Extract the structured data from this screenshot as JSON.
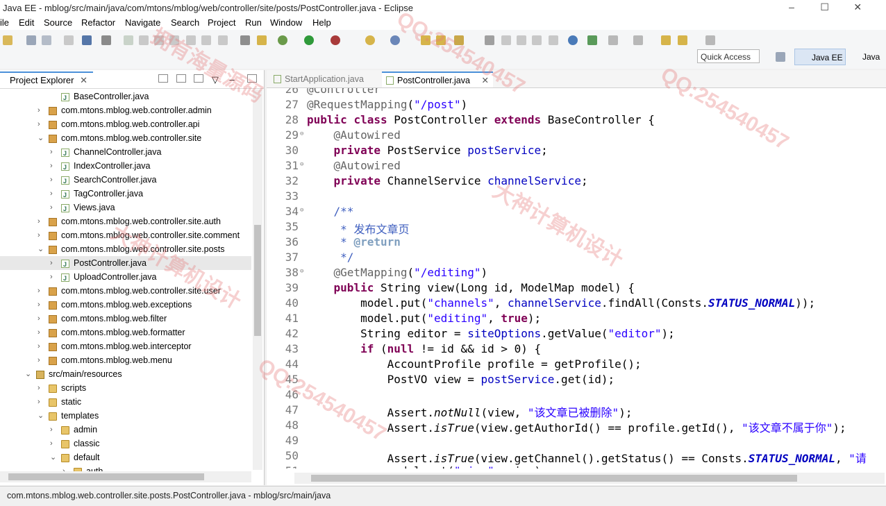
{
  "window": {
    "title": "Java EE - mblog/src/main/java/com/mtons/mblog/web/controller/site/posts/PostController.java - Eclipse"
  },
  "menu": [
    "ile",
    "Edit",
    "Source",
    "Refactor",
    "Navigate",
    "Search",
    "Project",
    "Run",
    "Window",
    "Help"
  ],
  "quick_access": {
    "placeholder": "Quick Access"
  },
  "perspectives": [
    {
      "label": "Java EE",
      "active": true
    },
    {
      "label": "Java",
      "active": false
    }
  ],
  "project_explorer": {
    "title": "Project Explorer",
    "rows": [
      {
        "label": "BaseController.java",
        "indent": 3,
        "icon": "java-file-icon",
        "arrow": ""
      },
      {
        "label": "com.mtons.mblog.web.controller.admin",
        "indent": 2,
        "icon": "package-icon",
        "arrow": ">"
      },
      {
        "label": "com.mtons.mblog.web.controller.api",
        "indent": 2,
        "icon": "package-icon",
        "arrow": ">"
      },
      {
        "label": "com.mtons.mblog.web.controller.site",
        "indent": 2,
        "icon": "package-icon",
        "arrow": "v"
      },
      {
        "label": "ChannelController.java",
        "indent": 3,
        "icon": "java-file-icon",
        "arrow": ">"
      },
      {
        "label": "IndexController.java",
        "indent": 3,
        "icon": "java-file-icon",
        "arrow": ">"
      },
      {
        "label": "SearchController.java",
        "indent": 3,
        "icon": "java-file-icon",
        "arrow": ">"
      },
      {
        "label": "TagController.java",
        "indent": 3,
        "icon": "java-file-icon",
        "arrow": ">"
      },
      {
        "label": "Views.java",
        "indent": 3,
        "icon": "java-file-icon",
        "arrow": ">"
      },
      {
        "label": "com.mtons.mblog.web.controller.site.auth",
        "indent": 2,
        "icon": "package-icon",
        "arrow": ">"
      },
      {
        "label": "com.mtons.mblog.web.controller.site.comment",
        "indent": 2,
        "icon": "package-icon",
        "arrow": ">"
      },
      {
        "label": "com.mtons.mblog.web.controller.site.posts",
        "indent": 2,
        "icon": "package-icon",
        "arrow": "v"
      },
      {
        "label": "PostController.java",
        "indent": 3,
        "icon": "java-file-icon",
        "arrow": ">",
        "selected": true
      },
      {
        "label": "UploadController.java",
        "indent": 3,
        "icon": "java-file-icon",
        "arrow": ">"
      },
      {
        "label": "com.mtons.mblog.web.controller.site.user",
        "indent": 2,
        "icon": "package-icon",
        "arrow": ">"
      },
      {
        "label": "com.mtons.mblog.web.exceptions",
        "indent": 2,
        "icon": "package-icon",
        "arrow": ">"
      },
      {
        "label": "com.mtons.mblog.web.filter",
        "indent": 2,
        "icon": "package-icon",
        "arrow": ">"
      },
      {
        "label": "com.mtons.mblog.web.formatter",
        "indent": 2,
        "icon": "package-icon",
        "arrow": ">"
      },
      {
        "label": "com.mtons.mblog.web.interceptor",
        "indent": 2,
        "icon": "package-icon",
        "arrow": ">"
      },
      {
        "label": "com.mtons.mblog.web.menu",
        "indent": 2,
        "icon": "package-icon",
        "arrow": ">"
      },
      {
        "label": "src/main/resources",
        "indent": 1,
        "icon": "source-folder-icon",
        "arrow": "v"
      },
      {
        "label": "scripts",
        "indent": 2,
        "icon": "folder-icon",
        "arrow": ">"
      },
      {
        "label": "static",
        "indent": 2,
        "icon": "folder-icon",
        "arrow": ">"
      },
      {
        "label": "templates",
        "indent": 2,
        "icon": "folder-icon",
        "arrow": "v"
      },
      {
        "label": "admin",
        "indent": 3,
        "icon": "folder-icon",
        "arrow": ">"
      },
      {
        "label": "classic",
        "indent": 3,
        "icon": "folder-icon",
        "arrow": ">"
      },
      {
        "label": "default",
        "indent": 3,
        "icon": "folder-icon",
        "arrow": "v"
      },
      {
        "label": "auth",
        "indent": 4,
        "icon": "folder-icon",
        "arrow": ">"
      }
    ]
  },
  "editor": {
    "tabs": [
      {
        "label": "StartApplication.java",
        "active": false
      },
      {
        "label": "PostController.java",
        "active": true
      }
    ],
    "lines": [
      {
        "n": "26",
        "fold": false,
        "segs": [
          [
            "an",
            "@Controller"
          ]
        ]
      },
      {
        "n": "27",
        "fold": false,
        "segs": [
          [
            "an",
            "@RequestMapping"
          ],
          [
            "",
            "("
          ],
          [
            "str",
            "\"/post\""
          ],
          [
            "",
            ")"
          ]
        ]
      },
      {
        "n": "28",
        "fold": false,
        "segs": [
          [
            "kw",
            "public"
          ],
          [
            "",
            " "
          ],
          [
            "kw",
            "class"
          ],
          [
            "",
            " PostController "
          ],
          [
            "kw",
            "extends"
          ],
          [
            "",
            " BaseController {"
          ]
        ]
      },
      {
        "n": "29",
        "fold": true,
        "segs": [
          [
            "",
            "    "
          ],
          [
            "an",
            "@Autowired"
          ]
        ]
      },
      {
        "n": "30",
        "fold": false,
        "segs": [
          [
            "",
            "    "
          ],
          [
            "kw",
            "private"
          ],
          [
            "",
            " PostService "
          ],
          [
            "fld",
            "postService"
          ],
          [
            "",
            ";"
          ]
        ]
      },
      {
        "n": "31",
        "fold": true,
        "segs": [
          [
            "",
            "    "
          ],
          [
            "an",
            "@Autowired"
          ]
        ]
      },
      {
        "n": "32",
        "fold": false,
        "segs": [
          [
            "",
            "    "
          ],
          [
            "kw",
            "private"
          ],
          [
            "",
            " ChannelService "
          ],
          [
            "fld",
            "channelService"
          ],
          [
            "",
            ";"
          ]
        ]
      },
      {
        "n": "33",
        "fold": false,
        "segs": []
      },
      {
        "n": "34",
        "fold": true,
        "segs": [
          [
            "",
            "    "
          ],
          [
            "cm",
            "/**"
          ]
        ]
      },
      {
        "n": "35",
        "fold": false,
        "segs": [
          [
            "",
            "     "
          ],
          [
            "cm",
            "* 发布文章页"
          ]
        ]
      },
      {
        "n": "36",
        "fold": false,
        "segs": [
          [
            "",
            "     "
          ],
          [
            "cm",
            "* "
          ],
          [
            "cmt",
            "@return"
          ]
        ]
      },
      {
        "n": "37",
        "fold": false,
        "segs": [
          [
            "",
            "     "
          ],
          [
            "cm",
            "*/"
          ]
        ]
      },
      {
        "n": "38",
        "fold": true,
        "segs": [
          [
            "",
            "    "
          ],
          [
            "an",
            "@GetMapping"
          ],
          [
            "",
            "("
          ],
          [
            "str",
            "\"/editing\""
          ],
          [
            "",
            ")"
          ]
        ]
      },
      {
        "n": "39",
        "fold": false,
        "segs": [
          [
            "",
            "    "
          ],
          [
            "kw",
            "public"
          ],
          [
            "",
            " String view(Long id, ModelMap model) {"
          ]
        ]
      },
      {
        "n": "40",
        "fold": false,
        "segs": [
          [
            "",
            "        model.put("
          ],
          [
            "str",
            "\"channels\""
          ],
          [
            "",
            ", "
          ],
          [
            "fld",
            "channelService"
          ],
          [
            "",
            ".findAll(Consts."
          ],
          [
            "sfld",
            "STATUS_NORMAL"
          ],
          [
            "",
            "));"
          ]
        ]
      },
      {
        "n": "41",
        "fold": false,
        "segs": [
          [
            "",
            "        model.put("
          ],
          [
            "str",
            "\"editing\""
          ],
          [
            "",
            ", "
          ],
          [
            "kw",
            "true"
          ],
          [
            "",
            ");"
          ]
        ]
      },
      {
        "n": "42",
        "fold": false,
        "segs": [
          [
            "",
            "        String editor = "
          ],
          [
            "fld",
            "siteOptions"
          ],
          [
            "",
            ".getValue("
          ],
          [
            "str",
            "\"editor\""
          ],
          [
            "",
            ");"
          ]
        ]
      },
      {
        "n": "43",
        "fold": false,
        "segs": [
          [
            "",
            "        "
          ],
          [
            "kw",
            "if"
          ],
          [
            "",
            " ("
          ],
          [
            "kw",
            "null"
          ],
          [
            "",
            " != id && id > 0) {"
          ]
        ]
      },
      {
        "n": "44",
        "fold": false,
        "segs": [
          [
            "",
            "            AccountProfile profile = getProfile();"
          ]
        ]
      },
      {
        "n": "45",
        "fold": false,
        "segs": [
          [
            "",
            "            PostVO view = "
          ],
          [
            "fld",
            "postService"
          ],
          [
            "",
            ".get(id);"
          ]
        ]
      },
      {
        "n": "46",
        "fold": false,
        "segs": []
      },
      {
        "n": "47",
        "fold": false,
        "segs": [
          [
            "",
            "            Assert."
          ],
          [
            "smeth",
            "notNull"
          ],
          [
            "",
            "(view, "
          ],
          [
            "str",
            "\"该文章已被删除\""
          ],
          [
            "",
            ");"
          ]
        ]
      },
      {
        "n": "48",
        "fold": false,
        "segs": [
          [
            "",
            "            Assert."
          ],
          [
            "smeth",
            "isTrue"
          ],
          [
            "",
            "(view.getAuthorId() == profile.getId(), "
          ],
          [
            "str",
            "\"该文章不属于你\""
          ],
          [
            "",
            ");"
          ]
        ]
      },
      {
        "n": "49",
        "fold": false,
        "segs": []
      },
      {
        "n": "50",
        "fold": false,
        "segs": [
          [
            "",
            "            Assert."
          ],
          [
            "smeth",
            "isTrue"
          ],
          [
            "",
            "(view.getChannel().getStatus() == Consts."
          ],
          [
            "sfld",
            "STATUS_NORMAL"
          ],
          [
            "",
            ", "
          ],
          [
            "str",
            "\"请"
          ]
        ]
      },
      {
        "n": "51",
        "fold": false,
        "segs": [
          [
            "",
            "            model.put("
          ],
          [
            "str",
            "\"view\""
          ],
          [
            "",
            ", view);"
          ]
        ]
      }
    ]
  },
  "status_bar": {
    "text": "com.mtons.mblog.web.controller.site.posts.PostController.java - mblog/src/main/java"
  },
  "watermarks": [
    "拥有海量源码",
    "QQ:254540457",
    "大神计算机设计"
  ]
}
